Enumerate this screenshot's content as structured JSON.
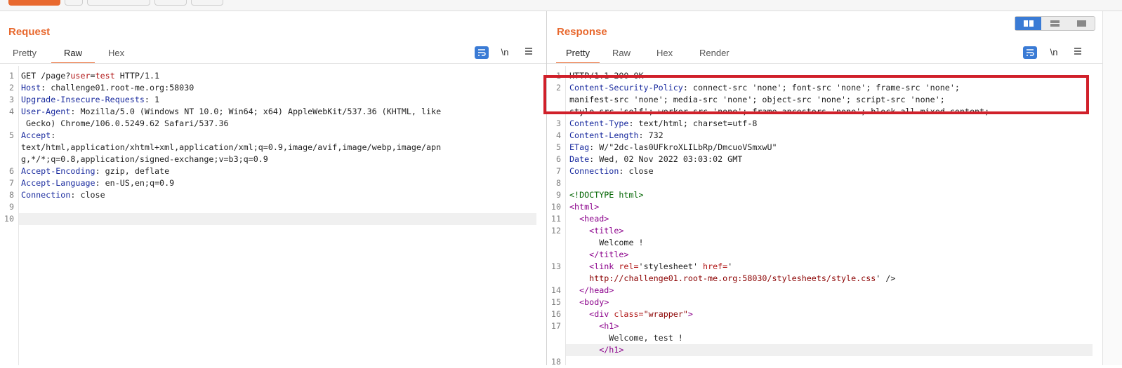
{
  "request": {
    "title": "Request",
    "tabs": [
      "Pretty",
      "Raw",
      "Hex"
    ],
    "active_tab": "Raw",
    "tools": {
      "wrap_icon": "wrap-lines-icon",
      "newline_label": "\\n",
      "menu_icon": "hamburger-menu-icon"
    },
    "lines": [
      {
        "n": "1",
        "segs": [
          [
            "GET /page?",
            ""
          ],
          [
            "user",
            "kw"
          ],
          [
            "=",
            ""
          ],
          [
            "test",
            "kw"
          ],
          [
            " HTTP/1.1",
            ""
          ]
        ]
      },
      {
        "n": "2",
        "segs": [
          [
            "Host",
            ""
          ],
          [
            ": challenge01.root-me.org:58030",
            ""
          ]
        ]
      },
      {
        "n": "3",
        "segs": [
          [
            "Upgrade-Insecure-Requests",
            ""
          ],
          [
            ": 1",
            ""
          ]
        ]
      },
      {
        "n": "4",
        "segs": [
          [
            "User-Agent",
            ""
          ],
          [
            ": Mozilla/5.0 (Windows NT 10.0; Win64; x64) AppleWebKit/537.36 (KHTML, like",
            ""
          ]
        ]
      },
      {
        "n": "",
        "segs": [
          [
            " Gecko) Chrome/106.0.5249.62 Safari/537.36",
            ""
          ]
        ]
      },
      {
        "n": "5",
        "segs": [
          [
            "Accept",
            ""
          ],
          [
            ":",
            ""
          ]
        ]
      },
      {
        "n": "",
        "segs": [
          [
            "text/html,application/xhtml+xml,application/xml;q=0.9,image/avif,image/webp,image/apn",
            ""
          ]
        ]
      },
      {
        "n": "",
        "segs": [
          [
            "g,*/*;q=0.8,application/signed-exchange;v=b3;q=0.9",
            ""
          ]
        ]
      },
      {
        "n": "6",
        "segs": [
          [
            "Accept-Encoding",
            ""
          ],
          [
            ": gzip, deflate",
            ""
          ]
        ]
      },
      {
        "n": "7",
        "segs": [
          [
            "Accept-Language",
            ""
          ],
          [
            ": en-US,en;q=0.9",
            ""
          ]
        ]
      },
      {
        "n": "8",
        "segs": [
          [
            "Connection",
            ""
          ],
          [
            ": close",
            ""
          ]
        ]
      },
      {
        "n": "9",
        "segs": []
      },
      {
        "n": "10",
        "segs": []
      }
    ]
  },
  "response": {
    "title": "Response",
    "tabs": [
      "Pretty",
      "Raw",
      "Hex",
      "Render"
    ],
    "active_tab": "Pretty",
    "tools": {
      "wrap_icon": "wrap-lines-icon",
      "newline_label": "\\n",
      "menu_icon": "hamburger-menu-icon"
    },
    "view_toggle": [
      "split-vertical-icon",
      "split-horizontal-icon",
      "single-pane-icon"
    ],
    "lines": [
      {
        "n": "1",
        "segs": [
          [
            "HTTP/1.1 200 OK",
            ""
          ]
        ]
      },
      {
        "n": "2",
        "segs": [
          [
            "Content-Security-Policy",
            ""
          ],
          [
            ": connect-src 'none'; font-src 'none'; frame-src 'none';",
            ""
          ]
        ]
      },
      {
        "n": "",
        "segs": [
          [
            "manifest-src 'none'; media-src 'none'; object-src 'none'; script-src 'none';",
            ""
          ]
        ]
      },
      {
        "n": "",
        "segs": [
          [
            "style-src 'self'; worker-src 'none'; frame-ancestors 'none'; block-all-mixed-content;",
            ""
          ]
        ]
      },
      {
        "n": "3",
        "segs": [
          [
            "Content-Type",
            ""
          ],
          [
            ": text/html; charset=utf-8",
            ""
          ]
        ]
      },
      {
        "n": "4",
        "segs": [
          [
            "Content-Length",
            ""
          ],
          [
            ": 732",
            ""
          ]
        ]
      },
      {
        "n": "5",
        "segs": [
          [
            "ETag",
            ""
          ],
          [
            ": W/\"2dc-las0UFkroXLILbRp/DmcuoVSmxwU\"",
            ""
          ]
        ]
      },
      {
        "n": "6",
        "segs": [
          [
            "Date",
            ""
          ],
          [
            ": Wed, 02 Nov 2022 03:03:02 GMT",
            ""
          ]
        ]
      },
      {
        "n": "7",
        "segs": [
          [
            "Connection",
            ""
          ],
          [
            ": close",
            ""
          ]
        ]
      },
      {
        "n": "8",
        "segs": []
      },
      {
        "n": "9",
        "segs": [
          [
            "<!DOCTYPE html>",
            "doctype"
          ]
        ]
      },
      {
        "n": "10",
        "segs": [
          [
            "<",
            "tag"
          ],
          [
            "html",
            "tag"
          ],
          [
            ">",
            "tag"
          ]
        ]
      },
      {
        "n": "11",
        "segs": [
          [
            "  ",
            ""
          ],
          [
            "<head>",
            "tag"
          ]
        ]
      },
      {
        "n": "12",
        "segs": [
          [
            "    ",
            ""
          ],
          [
            "<title>",
            "tag"
          ]
        ]
      },
      {
        "n": "",
        "segs": [
          [
            "      Welcome !",
            ""
          ]
        ]
      },
      {
        "n": "",
        "segs": [
          [
            "    ",
            ""
          ],
          [
            "</title>",
            "tag"
          ]
        ]
      },
      {
        "n": "13",
        "segs": [
          [
            "    ",
            ""
          ],
          [
            "<link ",
            "tag"
          ],
          [
            "rel=",
            "attr"
          ],
          [
            "'stylesheet' ",
            ""
          ],
          [
            "href=",
            "attr"
          ],
          [
            "'",
            ""
          ]
        ]
      },
      {
        "n": "",
        "segs": [
          [
            "    ",
            ""
          ],
          [
            "http://challenge01.root-me.org:58030/stylesheets/style.css",
            "str"
          ],
          [
            "' />",
            ""
          ]
        ]
      },
      {
        "n": "14",
        "segs": [
          [
            "  ",
            ""
          ],
          [
            "</head>",
            "tag"
          ]
        ]
      },
      {
        "n": "15",
        "segs": [
          [
            "  ",
            ""
          ],
          [
            "<body>",
            "tag"
          ]
        ]
      },
      {
        "n": "16",
        "segs": [
          [
            "    ",
            ""
          ],
          [
            "<div ",
            "tag"
          ],
          [
            "class=",
            "attr"
          ],
          [
            "\"wrapper\"",
            "str"
          ],
          [
            ">",
            "tag"
          ]
        ]
      },
      {
        "n": "17",
        "segs": [
          [
            "      ",
            ""
          ],
          [
            "<h1>",
            "tag"
          ]
        ]
      },
      {
        "n": "",
        "segs": [
          [
            "        Welcome, test !",
            ""
          ]
        ]
      },
      {
        "n": "",
        "segs": [
          [
            "      ",
            ""
          ],
          [
            "</h1>",
            "tag"
          ]
        ]
      },
      {
        "n": "18",
        "segs": []
      }
    ]
  },
  "colors": {
    "accent": "#e8692f",
    "header_key": "#1a2b9f",
    "highlight_box": "#d0202a",
    "button_blue": "#3a7bd5"
  }
}
